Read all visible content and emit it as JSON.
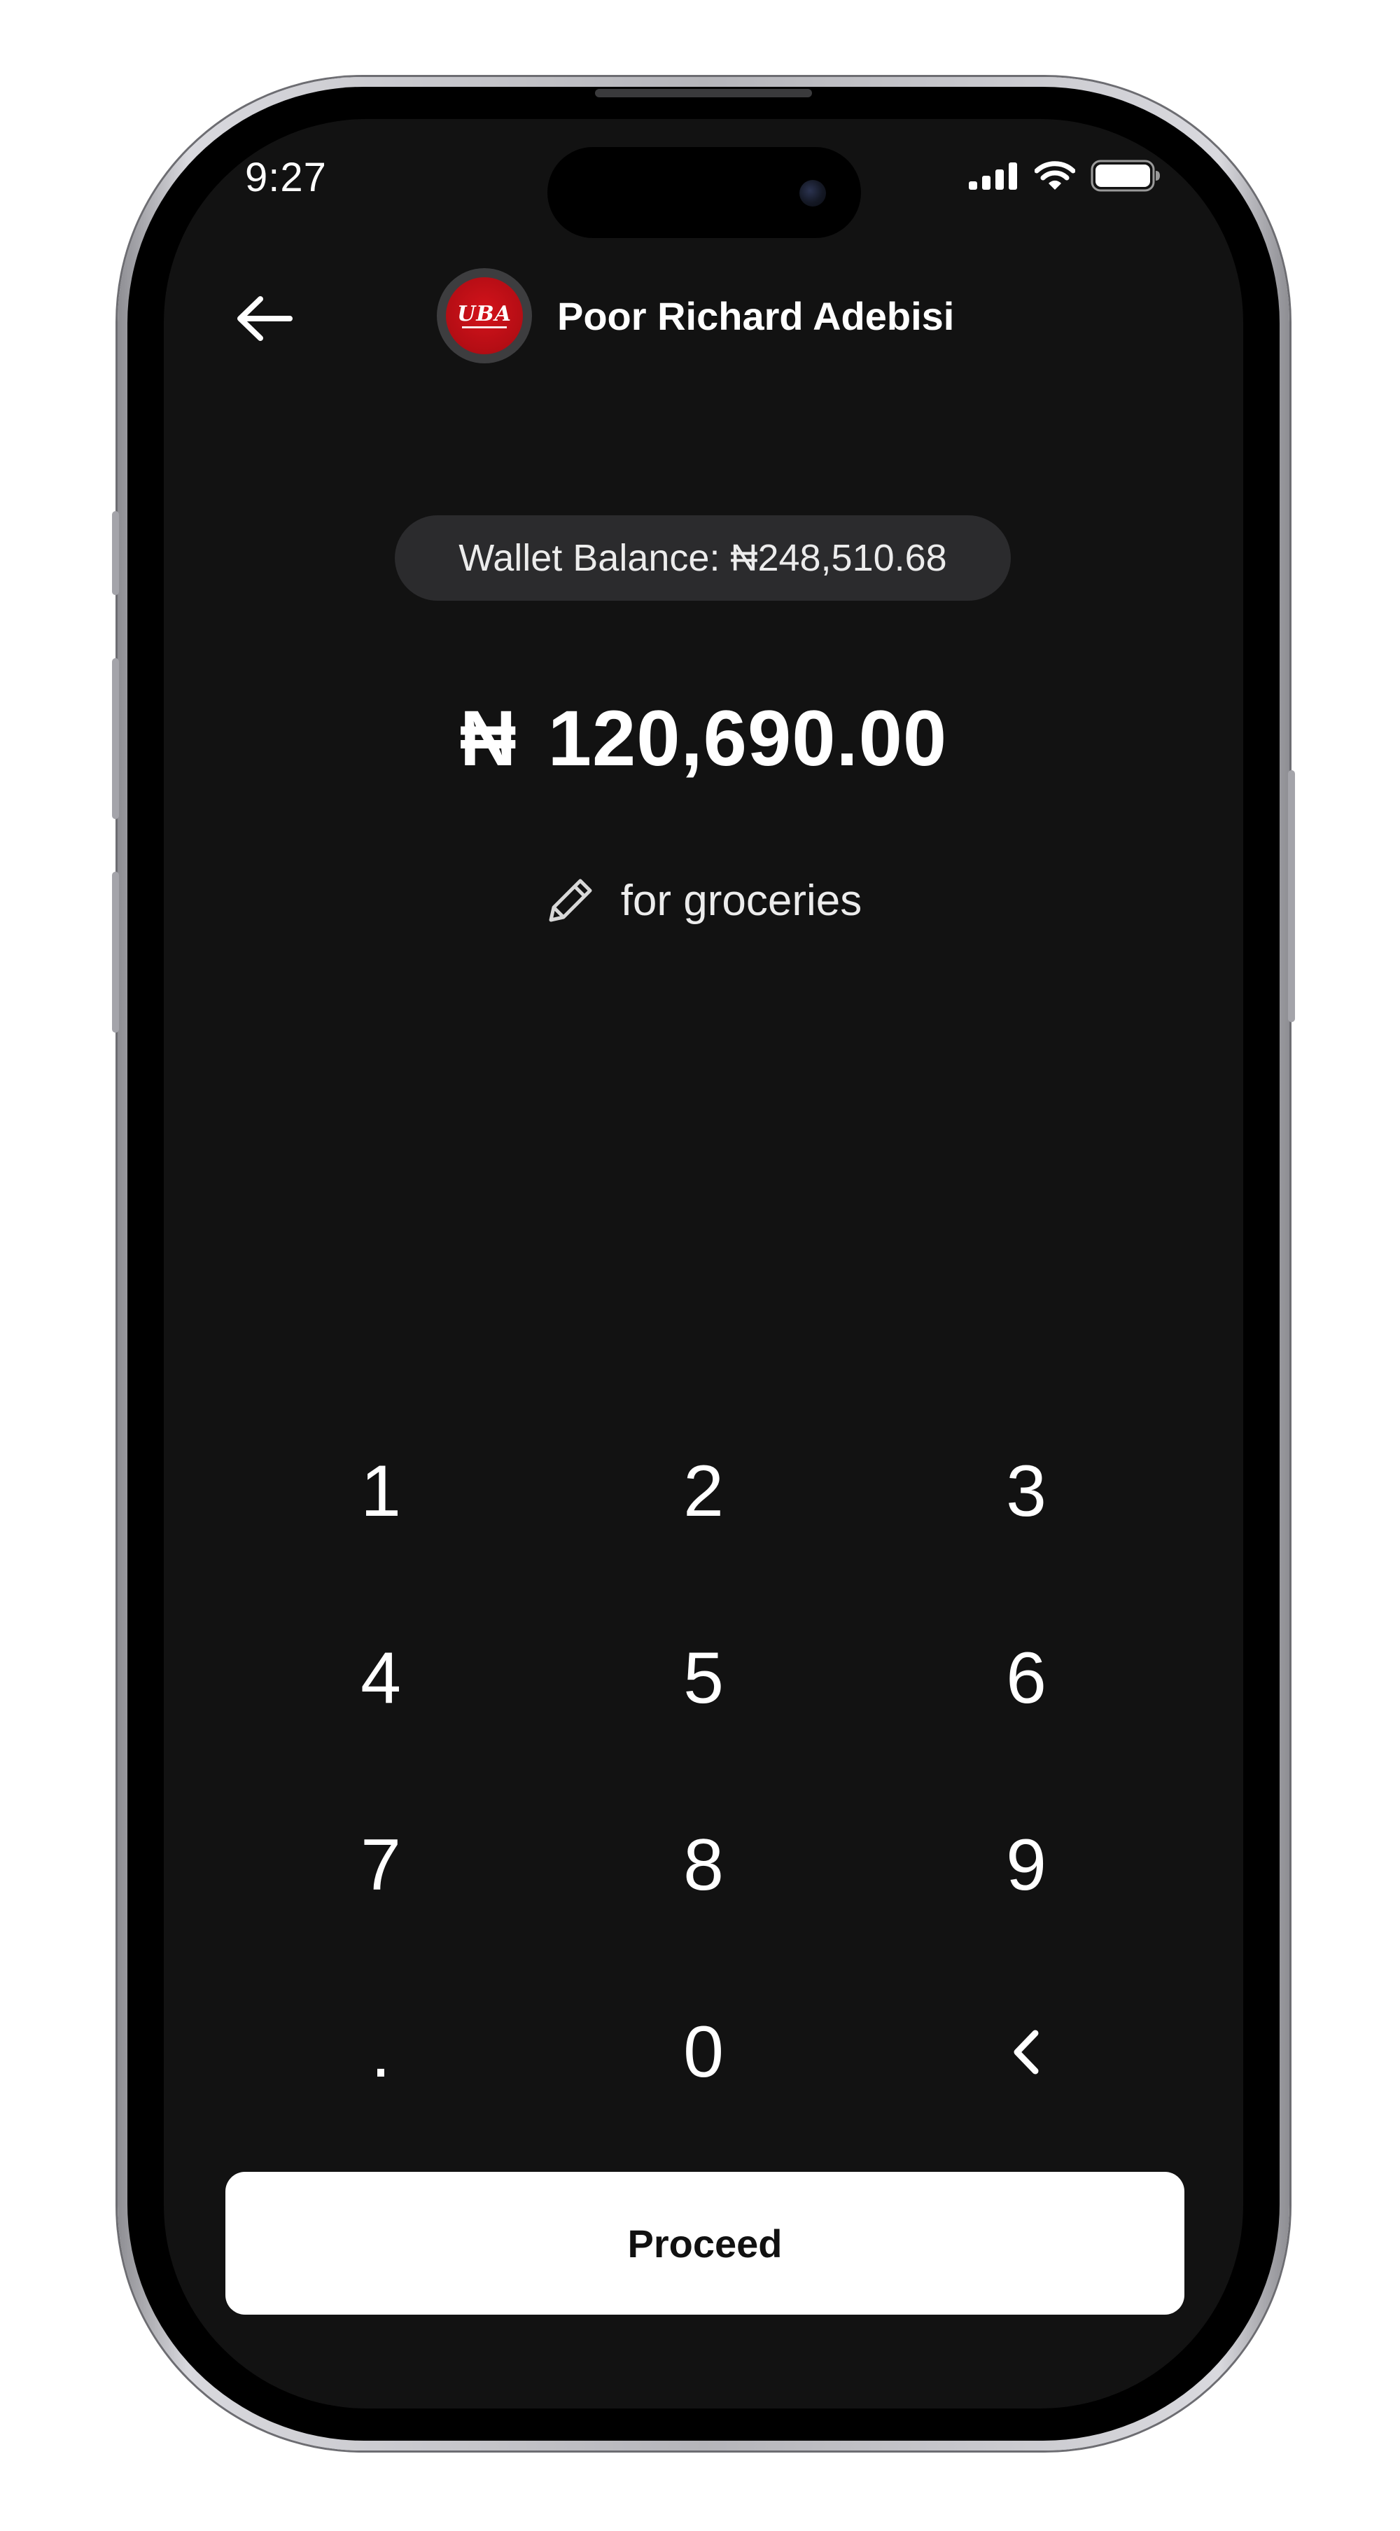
{
  "status_bar": {
    "time": "9:27"
  },
  "header": {
    "contact_name": "Poor Richard Adebisi",
    "avatar_logo": "UBA"
  },
  "wallet": {
    "balance_label": "Wallet Balance: ₦248,510.68"
  },
  "amount": {
    "currency": "₦",
    "value": "120,690.00"
  },
  "note": {
    "text": "for groceries"
  },
  "keypad": {
    "keys": [
      "1",
      "2",
      "3",
      "4",
      "5",
      "6",
      "7",
      "8",
      "9",
      ".",
      "0",
      "‹"
    ]
  },
  "proceed": {
    "label": "Proceed"
  },
  "icons": {
    "back": "arrow-left-icon",
    "note": "pencil-icon",
    "signal": "cellular-signal-icon",
    "wifi": "wifi-icon",
    "battery": "battery-icon"
  },
  "colors": {
    "background": "#121212",
    "pill": "#2b2b2d",
    "avatar_brand": "#d4131b",
    "button": "#ffffff"
  }
}
